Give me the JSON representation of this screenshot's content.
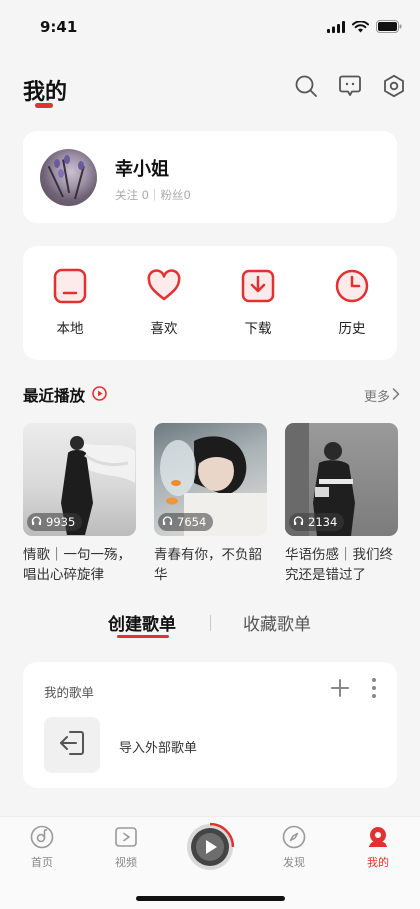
{
  "status_bar": {
    "time": "9:41"
  },
  "header": {
    "title": "我的"
  },
  "profile": {
    "name": "幸小姐",
    "meta": "关注 0｜粉丝0"
  },
  "quick_actions": [
    {
      "label": "本地",
      "icon": "local-music-icon"
    },
    {
      "label": "喜欢",
      "icon": "heart-icon"
    },
    {
      "label": "下载",
      "icon": "download-icon"
    },
    {
      "label": "历史",
      "icon": "clock-icon"
    }
  ],
  "recent": {
    "title": "最近播放",
    "more": "更多",
    "albums": [
      {
        "count": "9935",
        "caption": "情歌｜一句一殇，唱出心碎旋律"
      },
      {
        "count": "7654",
        "caption": "青春有你，不负韶华"
      },
      {
        "count": "2134",
        "caption": "华语伤感｜我们终究还是错过了"
      }
    ]
  },
  "tabs": {
    "created": "创建歌单",
    "collected": "收藏歌单"
  },
  "playlist": {
    "title": "我的歌单",
    "import_label": "导入外部歌单"
  },
  "bottom_nav": [
    {
      "label": "首页",
      "icon": "home-disc-icon"
    },
    {
      "label": "视频",
      "icon": "video-icon"
    },
    {
      "label": "发现",
      "icon": "compass-icon"
    },
    {
      "label": "我的",
      "icon": "profile-icon"
    }
  ],
  "colors": {
    "accent": "#e33131",
    "background": "#f5f5f5",
    "card": "#ffffff"
  }
}
